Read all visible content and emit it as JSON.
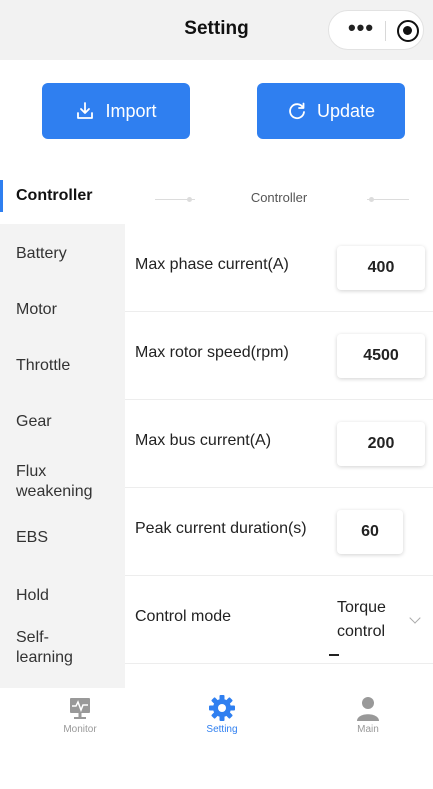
{
  "navbar": {
    "title": "Setting",
    "more_icon": "more-dots-icon",
    "close_icon": "close-miniapp-icon"
  },
  "actions": {
    "import_label": "Import",
    "update_label": "Update"
  },
  "sidebar": {
    "items": [
      {
        "label": "Controller",
        "active": true
      },
      {
        "label": "Battery"
      },
      {
        "label": "Motor"
      },
      {
        "label": "Throttle"
      },
      {
        "label": "Gear"
      },
      {
        "label": "Flux weakening"
      },
      {
        "label": "EBS"
      },
      {
        "label": "Hold"
      },
      {
        "label": "Self-learning"
      }
    ]
  },
  "section": {
    "title": "Controller"
  },
  "params": [
    {
      "label": "Max phase current(A)",
      "value": "400"
    },
    {
      "label": "Max rotor speed(rpm)",
      "value": "4500"
    },
    {
      "label": "Max bus current(A)",
      "value": "200"
    },
    {
      "label": "Peak current duration(s)",
      "value": "60"
    },
    {
      "label": "Control mode",
      "value": "Torque control"
    }
  ],
  "tabbar": {
    "tabs": [
      {
        "label": "Monitor",
        "icon": "monitor-icon"
      },
      {
        "label": "Setting",
        "icon": "gear-icon",
        "active": true
      },
      {
        "label": "Main",
        "icon": "user-icon"
      }
    ]
  },
  "colors": {
    "accent": "#2f7ff0",
    "sidebar_bg": "#f3f3f3"
  }
}
